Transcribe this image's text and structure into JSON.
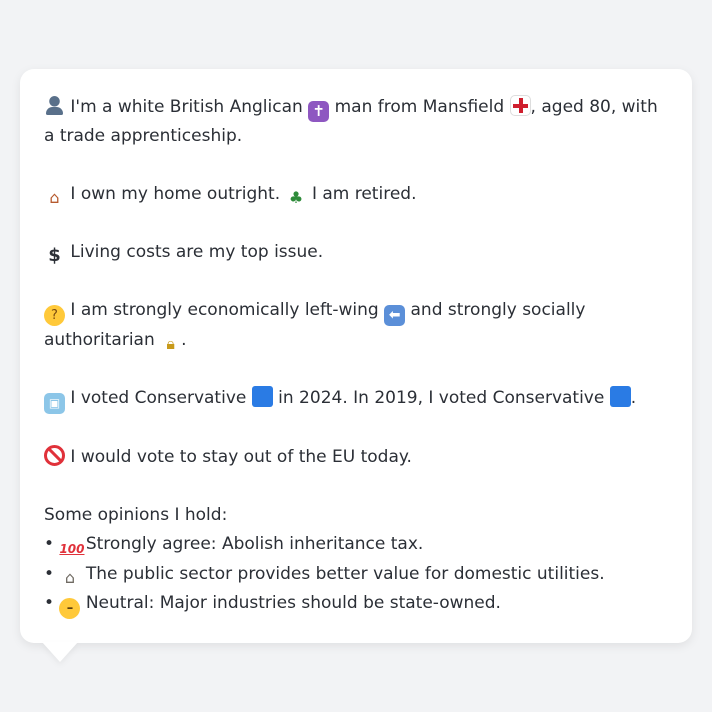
{
  "profile": {
    "line1_a": "I'm a white British Anglican",
    "line1_b": "man from Mansfield",
    "line1_c": ", aged 80, with a trade apprenticeship.",
    "home": "I own my home outright.",
    "retired": "I am retired.",
    "issue": "Living costs are my top issue.",
    "econ_a": "I am strongly economically left-wing",
    "econ_b": "and strongly socially authoritarian",
    "econ_c": ".",
    "vote_a": "I voted Conservative",
    "vote_b": "in 2024. In 2019, I voted Conservative",
    "vote_c": ".",
    "eu": "I would vote to stay out of the EU today."
  },
  "opinions": {
    "heading": "Some opinions I hold:",
    "bullet": "•",
    "items": [
      {
        "text": "Strongly agree: Abolish inheritance tax.",
        "icon": "hundred-points-icon"
      },
      {
        "text": "The public sector provides better value for domestic utilities.",
        "icon": "classical-building-icon"
      },
      {
        "text": "Neutral: Major industries should be state-owned.",
        "icon": "neutral-face-icon"
      }
    ]
  },
  "icons": {
    "person": "bust-in-silhouette-icon",
    "cross": "latin-cross-icon",
    "flag": "england-flag-icon",
    "house": "house-icon",
    "palm": "palm-tree-icon",
    "dollar": "dollar-sign-icon",
    "think": "thinking-face-icon",
    "left": "left-arrow-icon",
    "lock": "lock-icon",
    "ballot": "ballot-box-icon",
    "blue_square": "blue-square-icon",
    "no_entry": "prohibited-icon"
  },
  "glyphs": {
    "cross": "✝",
    "house": "⌂",
    "palm": "♣",
    "dollar": "$",
    "think": "?",
    "left": "⬅",
    "lock": "🔒︎",
    "ballot": "▣",
    "hundred": "100",
    "bank": "⌂",
    "neutral": "–"
  },
  "colors": {
    "background": "#f2f3f5",
    "card": "#ffffff",
    "text": "#2b2f36",
    "blue_square": "#2a7be4",
    "prohibited": "#e0313a"
  }
}
